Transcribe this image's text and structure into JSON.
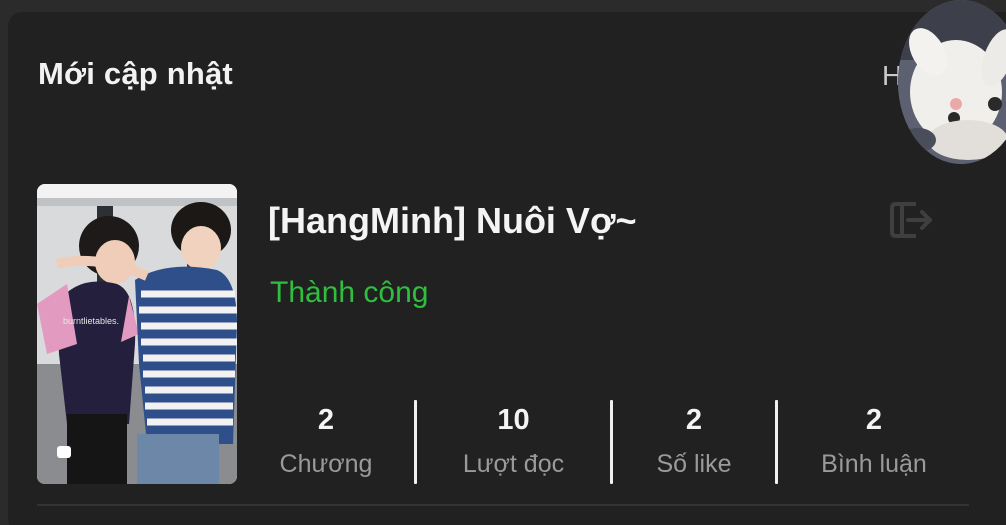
{
  "section": {
    "title": "Mới cập nhật",
    "see_all_label": "H"
  },
  "user": {
    "avatar_icon": "cat-avatar-icon"
  },
  "story": {
    "title": "[HangMinh] Nuôi Vợ~",
    "status": "Thành công",
    "status_color": "#2fbf3e",
    "cover_icon": "story-cover-image",
    "action_icon": "exit-icon",
    "stats": [
      {
        "value": "2",
        "label": "Chương"
      },
      {
        "value": "10",
        "label": "Lượt đọc"
      },
      {
        "value": "2",
        "label": "Số like"
      },
      {
        "value": "2",
        "label": "Bình luận"
      }
    ]
  }
}
